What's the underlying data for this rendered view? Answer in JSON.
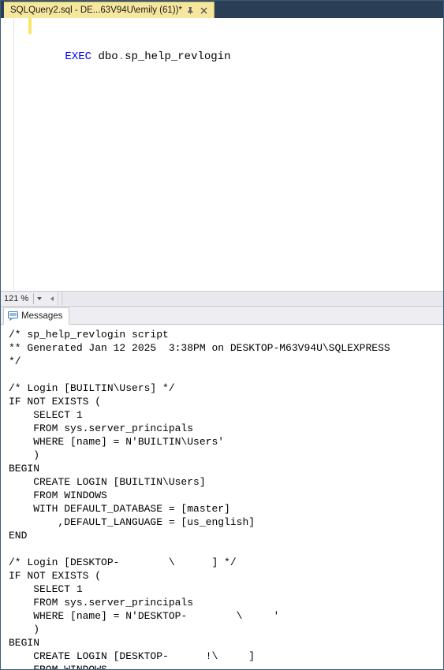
{
  "tab": {
    "title": "SQLQuery2.sql - DE...63V94U\\emily (61))*"
  },
  "editor": {
    "code_html": "<span class='kw-blue'>EXEC</span> <span class='kw-dark'>dbo</span><span style='color:#808080'>.</span><span class='kw-dark'>sp_help_revlogin</span>"
  },
  "zoom": {
    "value": "121 %"
  },
  "results_tab": {
    "label": "Messages"
  },
  "messages": {
    "text": "/* sp_help_revlogin script\n** Generated Jan 12 2025  3:38PM on DESKTOP-M63V94U\\SQLEXPRESS\n*/\n\n/* Login [BUILTIN\\Users] */\nIF NOT EXISTS (\n    SELECT 1\n    FROM sys.server_principals\n    WHERE [name] = N'BUILTIN\\Users'\n    )\nBEGIN\n    CREATE LOGIN [BUILTIN\\Users]\n    FROM WINDOWS\n    WITH DEFAULT_DATABASE = [master]\n        ,DEFAULT_LANGUAGE = [us_english]\nEND\n\n/* Login [DESKTOP-        \\      ] */\nIF NOT EXISTS (\n    SELECT 1\n    FROM sys.server_principals\n    WHERE [name] = N'DESKTOP-        \\     '\n    )\nBEGIN\n    CREATE LOGIN [DESKTOP-      !\\     ]\n    FROM WINDOWS"
  }
}
